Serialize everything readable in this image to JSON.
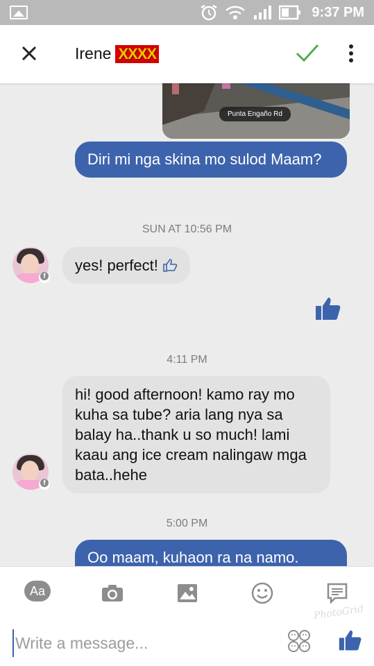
{
  "status_bar": {
    "time": "9:37 PM"
  },
  "header": {
    "contact_name": "Irene",
    "redacted_text": "XXXX"
  },
  "messages": {
    "map_label": "Punta Engaño Rd",
    "m1_text": "Diri mi nga skina mo sulod Maam?",
    "stamp1": "SUN AT 10:56 PM",
    "m2_text": "yes! perfect!",
    "stamp2": "4:11 PM",
    "m3_text": "hi! good afternoon! kamo ray mo kuha sa tube? aria lang nya sa balay ha..thank u so much! lami kaau ang ice cream nalingaw mga bata..hehe",
    "stamp3": "5:00 PM",
    "m4_text": "Oo maam, kuhaon ra na namo."
  },
  "toolbar": {
    "aa_label": "Aa",
    "icons": [
      "camera-icon",
      "gallery-icon",
      "emoji-icon",
      "chat-heads-icon"
    ],
    "input_placeholder": "Write a message...",
    "watermark": "PhotoGrid"
  },
  "colors": {
    "accent": "#3d63ac",
    "incoming_bubble": "#e2e2e2",
    "background": "#ececec",
    "check": "#4caf50"
  }
}
